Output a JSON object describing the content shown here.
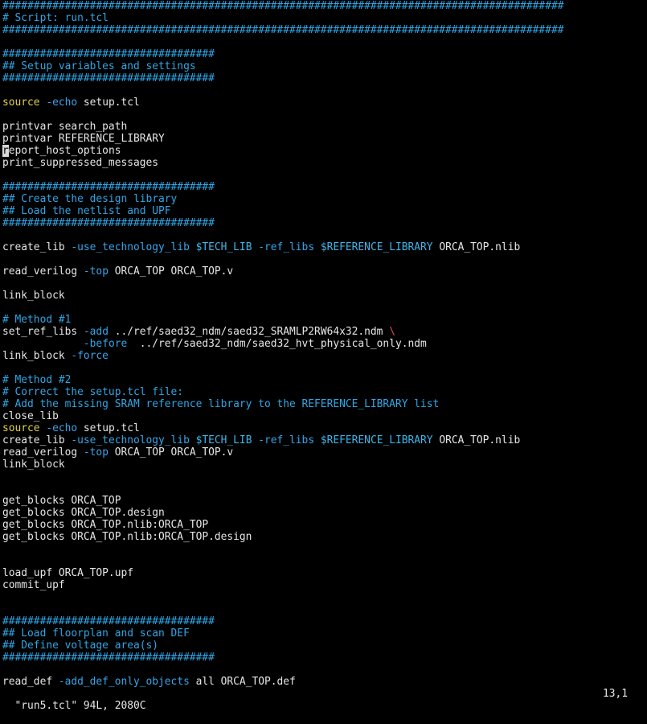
{
  "editor": {
    "lines": [
      [
        {
          "t": "##########################################################################################",
          "s": "c"
        }
      ],
      [
        {
          "t": "# Script: run.tcl",
          "s": "c"
        }
      ],
      [
        {
          "t": "##########################################################################################",
          "s": "c"
        }
      ],
      [],
      [
        {
          "t": "##################################",
          "s": "c"
        }
      ],
      [
        {
          "t": "## Setup variables and settings",
          "s": "c"
        }
      ],
      [
        {
          "t": "##################################",
          "s": "c"
        }
      ],
      [],
      [
        {
          "t": "source",
          "s": "kw"
        },
        {
          "t": " ",
          "s": "tx"
        },
        {
          "t": "-echo",
          "s": "op"
        },
        {
          "t": " setup.tcl",
          "s": "tx"
        }
      ],
      [],
      [
        {
          "t": "printvar search_path",
          "s": "tx"
        }
      ],
      [
        {
          "t": "printvar REFERENCE_LIBRARY",
          "s": "tx"
        }
      ],
      [
        {
          "t": "r",
          "s": "cursor"
        },
        {
          "t": "eport_host_options",
          "s": "tx"
        }
      ],
      [
        {
          "t": "print_suppressed_messages",
          "s": "tx"
        }
      ],
      [],
      [
        {
          "t": "##################################",
          "s": "c"
        }
      ],
      [
        {
          "t": "## Create the design library",
          "s": "c"
        }
      ],
      [
        {
          "t": "## Load the netlist and UPF",
          "s": "c"
        }
      ],
      [
        {
          "t": "##################################",
          "s": "c"
        }
      ],
      [],
      [
        {
          "t": "create_lib ",
          "s": "tx"
        },
        {
          "t": "-use_technology_lib",
          "s": "op"
        },
        {
          "t": " ",
          "s": "tx"
        },
        {
          "t": "$TECH_LIB",
          "s": "vr"
        },
        {
          "t": " ",
          "s": "tx"
        },
        {
          "t": "-ref_libs",
          "s": "op"
        },
        {
          "t": " ",
          "s": "tx"
        },
        {
          "t": "$REFERENCE_LIBRARY",
          "s": "vr"
        },
        {
          "t": " ORCA_TOP.nlib",
          "s": "tx"
        }
      ],
      [],
      [
        {
          "t": "read_verilog ",
          "s": "tx"
        },
        {
          "t": "-top",
          "s": "op"
        },
        {
          "t": " ORCA_TOP ORCA_TOP.v",
          "s": "tx"
        }
      ],
      [],
      [
        {
          "t": "link_block",
          "s": "tx"
        }
      ],
      [],
      [
        {
          "t": "# Method #1",
          "s": "c"
        }
      ],
      [
        {
          "t": "set_ref_libs ",
          "s": "tx"
        },
        {
          "t": "-add",
          "s": "op"
        },
        {
          "t": " ../ref/saed32_ndm/saed32_SRAMLP2RW64x32.ndm ",
          "s": "tx"
        },
        {
          "t": "\\",
          "s": "bs"
        }
      ],
      [
        {
          "t": "             ",
          "s": "tx"
        },
        {
          "t": "-before",
          "s": "op"
        },
        {
          "t": "  ../ref/saed32_ndm/saed32_hvt_physical_only.ndm",
          "s": "tx"
        }
      ],
      [
        {
          "t": "link_block ",
          "s": "tx"
        },
        {
          "t": "-force",
          "s": "op"
        }
      ],
      [],
      [
        {
          "t": "# Method #2",
          "s": "c"
        }
      ],
      [
        {
          "t": "# Correct the setup.tcl file:",
          "s": "c"
        }
      ],
      [
        {
          "t": "# Add the missing SRAM reference library to the REFERENCE_LIBRARY list",
          "s": "c"
        }
      ],
      [
        {
          "t": "close_lib",
          "s": "tx"
        }
      ],
      [
        {
          "t": "source",
          "s": "kw"
        },
        {
          "t": " ",
          "s": "tx"
        },
        {
          "t": "-echo",
          "s": "op"
        },
        {
          "t": " setup.tcl",
          "s": "tx"
        }
      ],
      [
        {
          "t": "create_lib ",
          "s": "tx"
        },
        {
          "t": "-use_technology_lib",
          "s": "op"
        },
        {
          "t": " ",
          "s": "tx"
        },
        {
          "t": "$TECH_LIB",
          "s": "vr"
        },
        {
          "t": " ",
          "s": "tx"
        },
        {
          "t": "-ref_libs",
          "s": "op"
        },
        {
          "t": " ",
          "s": "tx"
        },
        {
          "t": "$REFERENCE_LIBRARY",
          "s": "vr"
        },
        {
          "t": " ORCA_TOP.nlib",
          "s": "tx"
        }
      ],
      [
        {
          "t": "read_verilog ",
          "s": "tx"
        },
        {
          "t": "-top",
          "s": "op"
        },
        {
          "t": " ORCA_TOP ORCA_TOP.v",
          "s": "tx"
        }
      ],
      [
        {
          "t": "link_block",
          "s": "tx"
        }
      ],
      [],
      [],
      [
        {
          "t": "get_blocks ORCA_TOP",
          "s": "tx"
        }
      ],
      [
        {
          "t": "get_blocks ORCA_TOP.design",
          "s": "tx"
        }
      ],
      [
        {
          "t": "get_blocks ORCA_TOP.nlib:ORCA_TOP",
          "s": "tx"
        }
      ],
      [
        {
          "t": "get_blocks ORCA_TOP.nlib:ORCA_TOP.design",
          "s": "tx"
        }
      ],
      [],
      [],
      [
        {
          "t": "load_upf ORCA_TOP.upf",
          "s": "tx"
        }
      ],
      [
        {
          "t": "commit_upf",
          "s": "tx"
        }
      ],
      [],
      [],
      [
        {
          "t": "##################################",
          "s": "c"
        }
      ],
      [
        {
          "t": "## Load floorplan and scan DEF",
          "s": "c"
        }
      ],
      [
        {
          "t": "## Define voltage area(s)",
          "s": "c"
        }
      ],
      [
        {
          "t": "##################################",
          "s": "c"
        }
      ],
      [],
      [
        {
          "t": "read_def ",
          "s": "tx"
        },
        {
          "t": "-add_def_only_objects",
          "s": "op"
        },
        {
          "t": " all ORCA_TOP.def",
          "s": "tx"
        }
      ]
    ]
  },
  "statusbar": {
    "file_info": "\"run5.tcl\" 94L, 2080C",
    "cursor_pos": "13,1"
  },
  "colors": {
    "background": "#000000",
    "comment": "#2ea6e6",
    "keyword": "#e0d24a",
    "option": "#35a5ea",
    "variable": "#3db6e8",
    "line_continuation": "#e05050",
    "text": "#e6e6e6"
  }
}
